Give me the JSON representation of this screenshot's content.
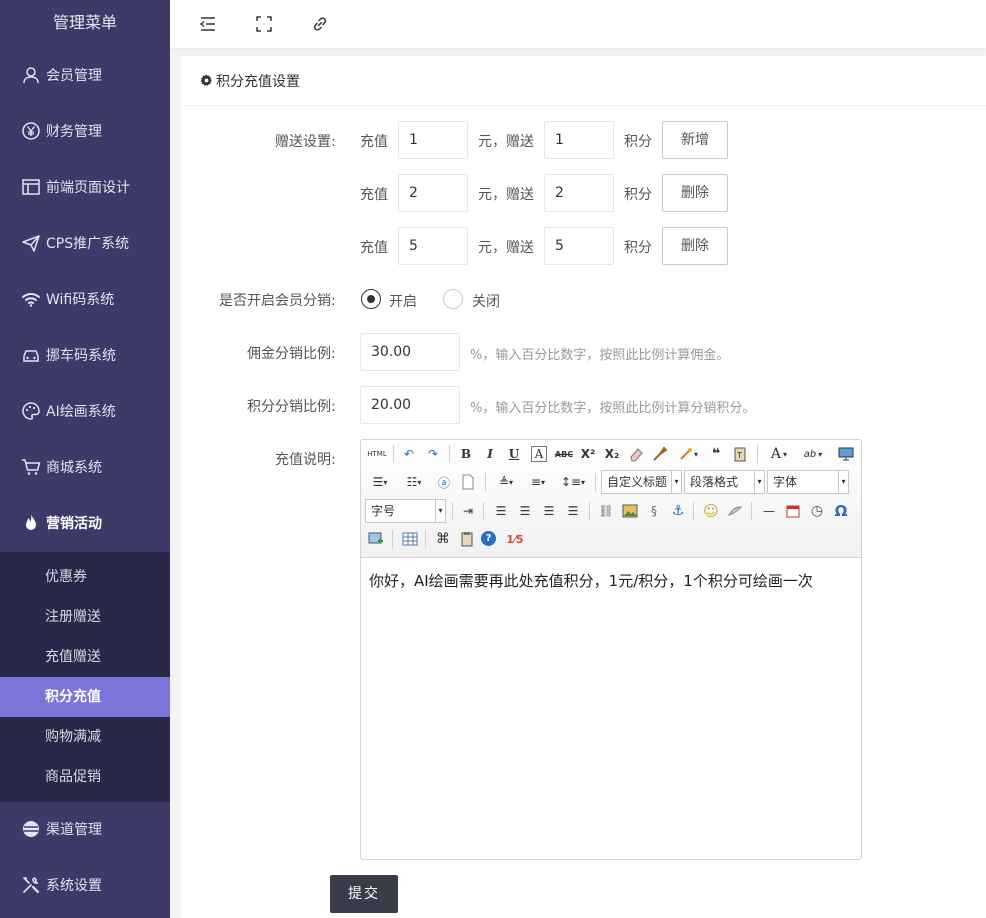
{
  "sidebar": {
    "title": "管理菜单",
    "items": [
      {
        "label": "会员管理",
        "icon": "user-icon"
      },
      {
        "label": "财务管理",
        "icon": "yen-icon"
      },
      {
        "label": "前端页面设计",
        "icon": "layout-icon"
      },
      {
        "label": "CPS推广系统",
        "icon": "send-icon"
      },
      {
        "label": "Wifi码系统",
        "icon": "wifi-icon"
      },
      {
        "label": "挪车码系统",
        "icon": "car-icon"
      },
      {
        "label": "AI绘画系统",
        "icon": "palette-icon"
      },
      {
        "label": "商城系统",
        "icon": "cart-icon"
      },
      {
        "label": "营销活动",
        "icon": "fire-icon"
      },
      {
        "label": "渠道管理",
        "icon": "channel-icon"
      },
      {
        "label": "系统设置",
        "icon": "tools-icon"
      }
    ],
    "submenu": [
      "优惠券",
      "注册赠送",
      "充值赠送",
      "积分充值",
      "购物满减",
      "商品促销"
    ],
    "active_sub": "积分充值"
  },
  "topbar": {
    "icons": [
      "menu-collapse-icon",
      "fullscreen-icon",
      "link-icon"
    ]
  },
  "card": {
    "title": "积分充值设置"
  },
  "form": {
    "gift_label": "赠送设置:",
    "recharge_text": "充值",
    "yuan_gift_text": "元，赠送",
    "points_text": "积分",
    "rows": [
      {
        "recharge": "1",
        "gift": "1",
        "button": "新增"
      },
      {
        "recharge": "2",
        "gift": "2",
        "button": "删除"
      },
      {
        "recharge": "5",
        "gift": "5",
        "button": "删除"
      }
    ],
    "distribution_label": "是否开启会员分销:",
    "radio_on": "开启",
    "radio_off": "关闭",
    "commission_label": "佣金分销比例:",
    "commission_value": "30.00",
    "commission_hint": "%，输入百分比数字，按照此比例计算佣金。",
    "points_ratio_label": "积分分销比例:",
    "points_ratio_value": "20.00",
    "points_ratio_hint": "%，输入百分比数字，按照此比例计算分销积分。",
    "desc_label": "充值说明:",
    "editor": {
      "select_title": "自定义标题",
      "select_paragraph": "段落格式",
      "select_font": "字体",
      "select_size": "字号",
      "content": "你好，AI绘画需要再此处充值积分，1元/积分，1个积分可绘画一次"
    },
    "submit": "提交"
  },
  "colors": {
    "sidebar": "#3d3a6a",
    "submenu": "#2a2848",
    "active": "#7b75d9",
    "submit": "#393d49"
  }
}
